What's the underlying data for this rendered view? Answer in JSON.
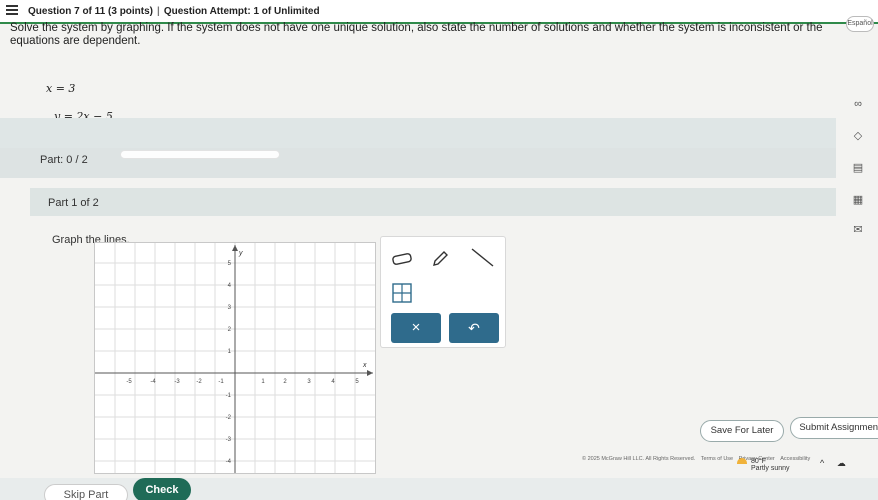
{
  "header": {
    "question_info": "Question 7 of 11 (3 points)",
    "attempt_info": "Question Attempt: 1 of Unlimited",
    "separator": "|",
    "expand_label": "Español"
  },
  "problem": {
    "prompt": "Solve the system by graphing. If the system does not have one unique solution, also state the number of solutions and whether the system is inconsistent or the equations are dependent.",
    "eq1": "x = 3",
    "eq2": "y = 2x − 5"
  },
  "part": {
    "label": "Part: 0 / 2",
    "progress": 0,
    "current_label": "Part 1 of 2",
    "instruction": "Graph the lines."
  },
  "graph": {
    "x_ticks": [
      "-5",
      "-4",
      "-3",
      "-2",
      "-1",
      "1",
      "2",
      "3",
      "4",
      "5"
    ],
    "y_ticks": [
      "5",
      "4",
      "3",
      "2",
      "1",
      "-1",
      "-2",
      "-3",
      "-4"
    ],
    "x_label": "x",
    "y_label": "y"
  },
  "tools": {
    "eraser_icon": "eraser-icon",
    "pencil_icon": "pencil-icon",
    "line_icon": "line-icon",
    "grid_icon": "grid-icon",
    "clear_label": "×",
    "undo_label": "↶"
  },
  "actions": {
    "save_label": "Save For Later",
    "submit_label": "Submit Assignment",
    "skip_label": "Skip Part",
    "check_label": "Check"
  },
  "footer": {
    "copyright": "© 2025 McGraw Hill LLC. All Rights Reserved.",
    "terms": "Terms of Use",
    "privacy": "Privacy Center",
    "accessibility": "Accessibility"
  },
  "taskbar": {
    "temp": "80°F",
    "weather": "Partly sunny"
  },
  "colors": {
    "accent_green": "#2f8a4a",
    "check_button": "#1f6b57",
    "tool_button": "#2f6b8c"
  }
}
